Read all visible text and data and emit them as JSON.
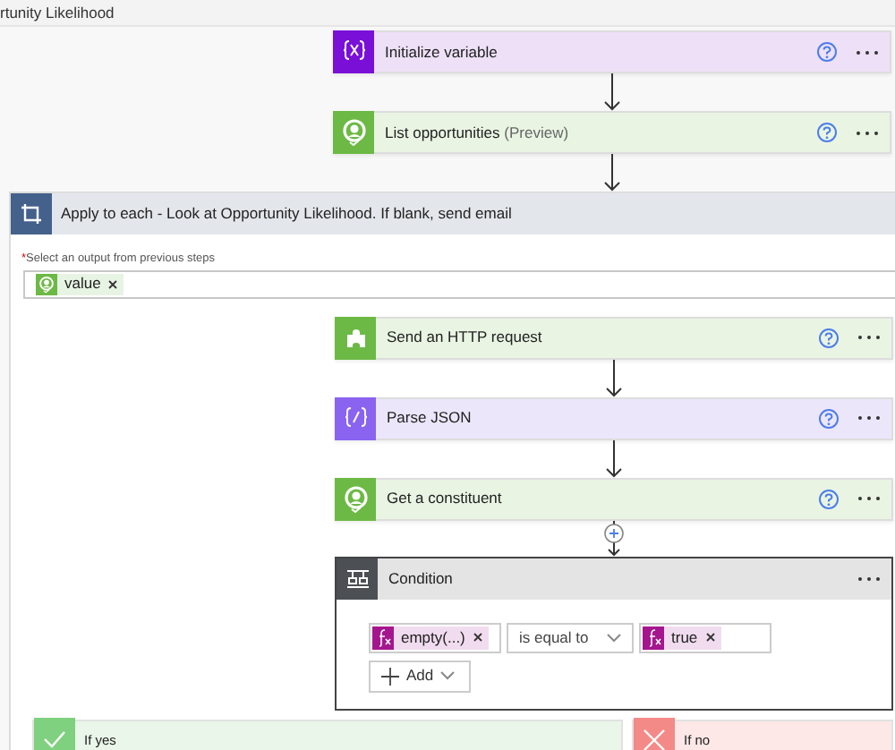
{
  "header": {
    "title": "rtunity Likelihood"
  },
  "steps": [
    {
      "kind": "variable",
      "title": "Initialize variable"
    },
    {
      "kind": "connector",
      "title": "List opportunities",
      "note": "(Preview)"
    }
  ],
  "loop": {
    "title": "Apply to each - Look at Opportunity Likelihood. If blank, send email",
    "field_label": "Select an output from previous steps",
    "required_mark": "*",
    "tokens": [
      {
        "label": "value"
      }
    ],
    "steps": [
      {
        "kind": "http",
        "title": "Send an HTTP request"
      },
      {
        "kind": "parse",
        "title": "Parse JSON"
      },
      {
        "kind": "connector",
        "title": "Get a constituent"
      }
    ],
    "condition": {
      "title": "Condition",
      "left": {
        "label": "empty(...)"
      },
      "operator": "is equal to",
      "right": {
        "label": "true"
      },
      "add_label": "Add"
    },
    "branches": [
      {
        "kind": "yes",
        "title": "If yes"
      },
      {
        "kind": "no",
        "title": "If no"
      }
    ]
  }
}
